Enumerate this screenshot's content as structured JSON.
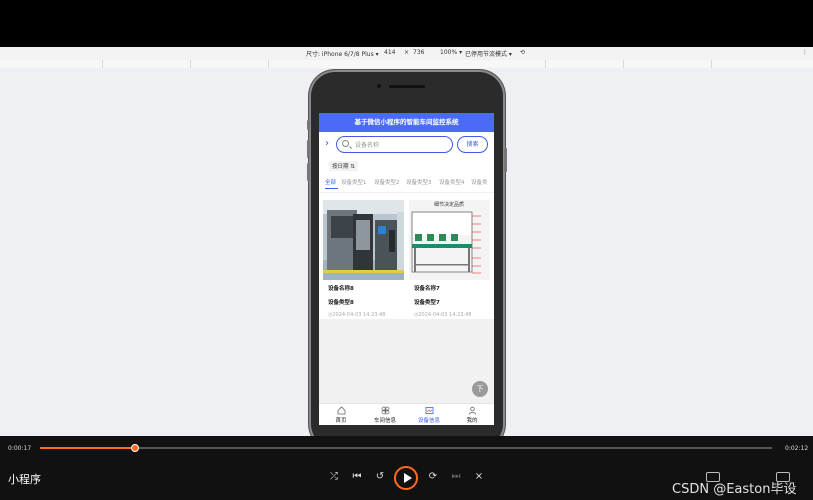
{
  "devtools": {
    "device_label": "尺寸: iPhone 6/7/8 Plus",
    "width": "414",
    "x_sep": "×",
    "height": "736",
    "zoom": "100%",
    "throttle": "已停用节流模式"
  },
  "app": {
    "title": "基于微信小程序的智能车间监控系统",
    "search": {
      "placeholder": "设备名称",
      "button": "搜索"
    },
    "sort_label": "按日期",
    "tabs": [
      "全部",
      "设备类型1",
      "设备类型2",
      "设备类型3",
      "设备类型4",
      "设备类"
    ],
    "cards": [
      {
        "name": "设备名称8",
        "type": "设备类型8",
        "time": "2024-04-03 14:23:48"
      },
      {
        "name": "设备名称7",
        "type": "设备类型7",
        "time": "2024-04-03 14:23:48",
        "image_caption": "细节决定品质"
      }
    ],
    "top_button": "下",
    "nav": [
      "首页",
      "车间信息",
      "设备信息",
      "我的"
    ],
    "nav_active": 2
  },
  "player": {
    "current_time": "0:00:17",
    "total_time": "0:02:12",
    "progress": 0.13,
    "title": "小程序",
    "accent": "#ff6a21"
  },
  "watermark": "CSDN @Easton毕设"
}
